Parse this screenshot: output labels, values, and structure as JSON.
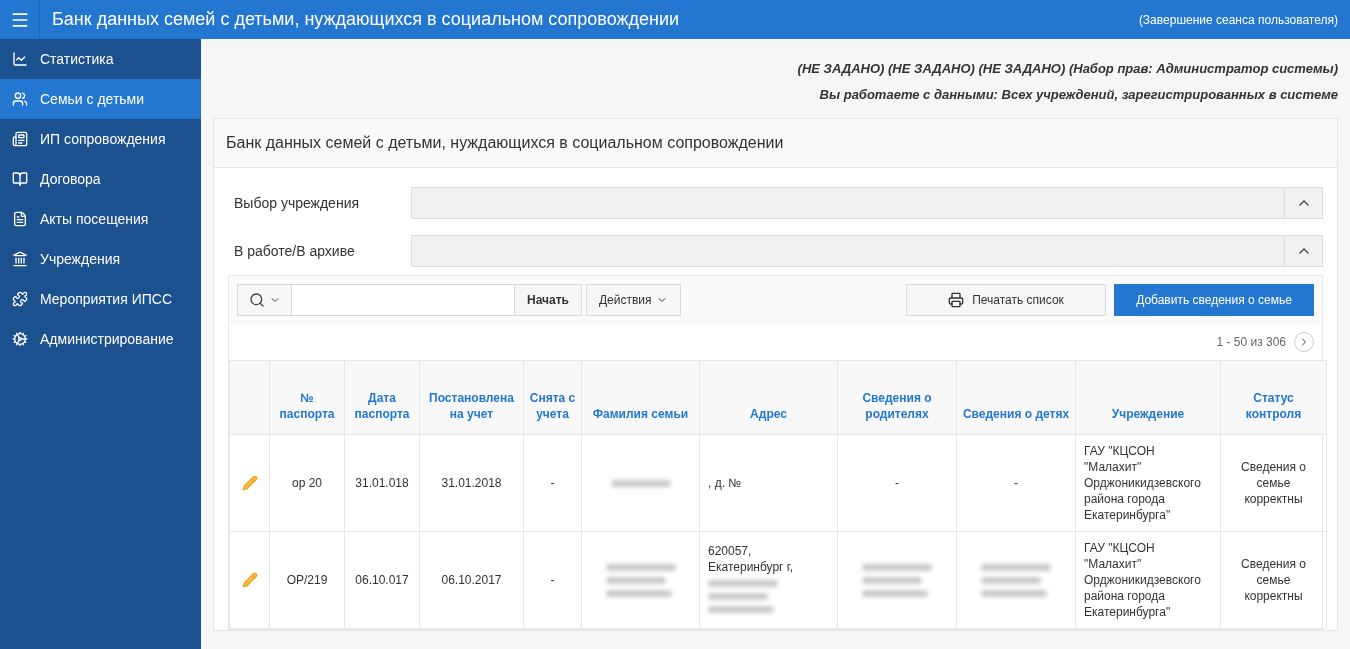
{
  "header": {
    "title": "Банк данных семей с детьми, нуждающихся в социальном сопровождении",
    "logout": "(Завершение сеанса пользователя)"
  },
  "sidebar": {
    "items": [
      {
        "label": "Статистика",
        "selected": false
      },
      {
        "label": "Семьи с детьми",
        "selected": true
      },
      {
        "label": "ИП сопровождения",
        "selected": false
      },
      {
        "label": "Договора",
        "selected": false
      },
      {
        "label": "Акты посещения",
        "selected": false
      },
      {
        "label": "Учреждения",
        "selected": false
      },
      {
        "label": "Мероприятия ИПСС",
        "selected": false
      },
      {
        "label": "Администрирование",
        "selected": false
      }
    ]
  },
  "user_info": [
    "(НЕ ЗАДАНО) (НЕ ЗАДАНО) (НЕ ЗАДАНО) (Набор прав: Администратор системы)",
    "Вы работаете с данными: Всех учреждений, зарегистрированных в системе"
  ],
  "card": {
    "title": "Банк данных семей с детьми, нуждающихся в социальном сопровождении"
  },
  "filters": [
    {
      "label": "Выбор учреждения"
    },
    {
      "label": "В работе/В архиве"
    }
  ],
  "toolbar": {
    "go_button": "Начать",
    "actions_button": "Действия",
    "print_button": "Печатать список",
    "add_button": "Добавить сведения о семье",
    "pagination": "1 - 50 из 306"
  },
  "table": {
    "columns": [
      "",
      "№ паспорта",
      "Дата паспорта",
      "Постановлена на учет",
      "Снята с учета",
      "Фамилия семьи",
      "Адрес",
      "Сведения о родителях",
      "Сведения о детях",
      "Учреждение",
      "Статус контроля"
    ],
    "rows": [
      {
        "cells": [
          [
            {
              "kind": "edit"
            }
          ],
          [
            {
              "kind": "text",
              "text": "ор 20"
            }
          ],
          [
            {
              "kind": "text",
              "text": "31.01.018"
            }
          ],
          [
            {
              "kind": "text",
              "text": "31.01.2018"
            }
          ],
          [
            {
              "kind": "text",
              "text": "-"
            }
          ],
          [
            {
              "kind": "blurred_line"
            }
          ],
          [
            {
              "kind": "text",
              "text": ", д. №"
            }
          ],
          [
            {
              "kind": "text",
              "text": "-"
            }
          ],
          [
            {
              "kind": "text",
              "text": "-"
            }
          ],
          [
            {
              "kind": "text",
              "text": "ГАУ \"КЦСОН \"Малахит\" Орджоникидзевского района города Екатеринбурга\""
            }
          ],
          [
            {
              "kind": "text",
              "text": "Сведения о семье корректны"
            }
          ]
        ]
      },
      {
        "cells": [
          [
            {
              "kind": "edit"
            }
          ],
          [
            {
              "kind": "text",
              "text": "ОР/219"
            }
          ],
          [
            {
              "kind": "text",
              "text": "06.10.017"
            }
          ],
          [
            {
              "kind": "text",
              "text": "06.10.2017"
            }
          ],
          [
            {
              "kind": "text",
              "text": "-"
            }
          ],
          [
            {
              "kind": "blurred_block"
            }
          ],
          [
            {
              "kind": "text",
              "text": "620057, Екатеринбург г,"
            },
            {
              "kind": "blurred_block"
            }
          ],
          [
            {
              "kind": "blurred_block"
            }
          ],
          [
            {
              "kind": "blurred_block"
            }
          ],
          [
            {
              "kind": "text",
              "text": "ГАУ \"КЦСОН \"Малахит\" Орджоникидзевского района города Екатеринбурга\""
            }
          ],
          [
            {
              "kind": "text",
              "text": "Сведения о семье корректны"
            }
          ]
        ]
      }
    ]
  }
}
